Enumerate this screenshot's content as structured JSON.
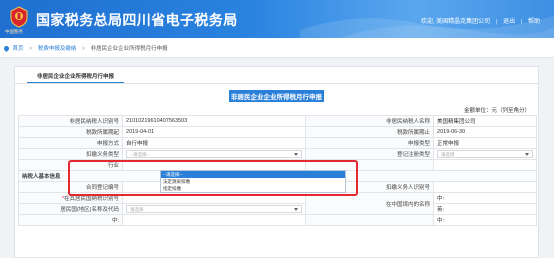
{
  "header": {
    "title": "国家税务总局四川省电子税务局",
    "logo_sub": "中国税务",
    "welcome": "欢迎, 美国精晶克集团公司",
    "exit": "退出",
    "help": "帮助"
  },
  "breadcrumb": {
    "home": "首页",
    "section": "税费申报及缴纳",
    "current": "非居民企业企业所得税月行申报"
  },
  "tab": {
    "label": "非居民企业企业所得税月行申报"
  },
  "form": {
    "title": "非居民企业企业所得税月行申报",
    "unit": "金额单位：元（列至角分）",
    "rows": {
      "r1": {
        "l1": "非居民纳税人识别号",
        "v1": "21010219610407563503",
        "l2": "非居民纳税人名称",
        "v2": "美国精集团公司"
      },
      "r2": {
        "l1": "税款所属期起",
        "v1": "2019-04-01",
        "l2": "税款所属期止",
        "v2": "2019-06-30"
      },
      "r3": {
        "l1": "申报方式",
        "v1": "自行申报",
        "l2": "申报类型",
        "v2": "正常申报"
      },
      "r4": {
        "l1": "扣缴义务类型",
        "v1": "--请选择--",
        "l2": "登记注册类型",
        "v2": "请选择"
      },
      "r5": {
        "l1": "行业"
      },
      "section": "纳税人基本信息",
      "r7": {
        "l1": "合同登记编号",
        "l2": "扣缴义务人识别号"
      },
      "r8": {
        "l1": "在其居民国纳税识别号",
        "l2": "中:"
      },
      "r9": {
        "l1": "居民国(地区)名称及代码",
        "v1": "请选择",
        "l2": "在中国境内的名称",
        "v2": "英:"
      },
      "r10": {
        "l1": "中:",
        "l2": "中:"
      }
    }
  },
  "dropdown": {
    "options": [
      "--请选择--",
      "法定源泉扣缴",
      "指定扣缴"
    ],
    "selected_index": 0
  }
}
